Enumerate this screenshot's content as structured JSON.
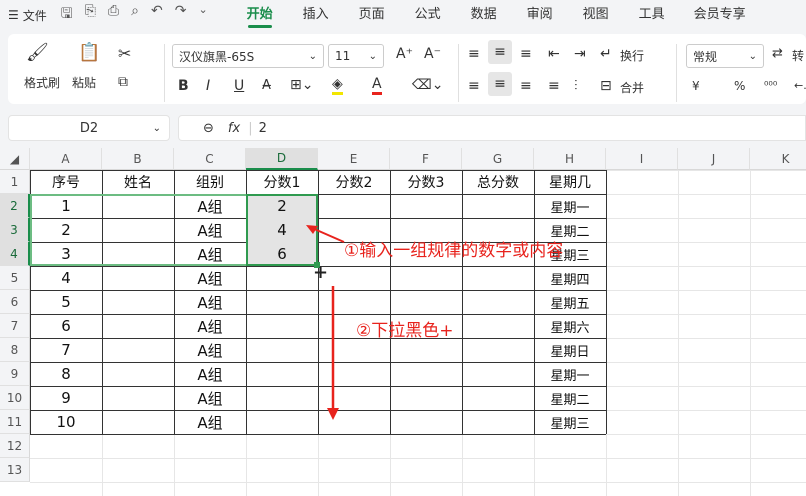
{
  "menu": {
    "file_icon": "hamburger-icon",
    "file": "文件",
    "tabs": [
      "开始",
      "插入",
      "页面",
      "公式",
      "数据",
      "审阅",
      "视图",
      "工具",
      "会员专享"
    ]
  },
  "ribbon": {
    "format_painter": "格式刷",
    "paste": "粘贴",
    "font_name": "汉仪旗黑-65S",
    "font_size": "11",
    "bold": "B",
    "italic": "I",
    "underline": "U",
    "wrap": "换行",
    "merge": "合并",
    "number_format": "常规",
    "convert": "转",
    "currency": "¥",
    "percent": "%"
  },
  "namebox": "D2",
  "formula": "2",
  "fx": "fx",
  "columns": [
    "A",
    "B",
    "C",
    "D",
    "E",
    "F",
    "G",
    "H",
    "I",
    "J",
    "K"
  ],
  "rows": [
    "1",
    "2",
    "3",
    "4",
    "5",
    "6",
    "7",
    "8",
    "9",
    "10",
    "11",
    "12",
    "13"
  ],
  "headers": [
    "序号",
    "姓名",
    "组别",
    "分数1",
    "分数2",
    "分数3",
    "总分数",
    "星期几"
  ],
  "table": [
    [
      "1",
      "",
      "A组",
      "2",
      "星期一"
    ],
    [
      "2",
      "",
      "A组",
      "4",
      "星期二"
    ],
    [
      "3",
      "",
      "A组",
      "6",
      "星期三"
    ],
    [
      "4",
      "",
      "A组",
      "",
      "星期四"
    ],
    [
      "5",
      "",
      "A组",
      "",
      "星期五"
    ],
    [
      "6",
      "",
      "A组",
      "",
      "星期六"
    ],
    [
      "7",
      "",
      "A组",
      "",
      "星期日"
    ],
    [
      "8",
      "",
      "A组",
      "",
      "星期一"
    ],
    [
      "9",
      "",
      "A组",
      "",
      "星期二"
    ],
    [
      "10",
      "",
      "A组",
      "",
      "星期三"
    ]
  ],
  "annotations": {
    "a1": "①输入一组规律的数字或内容",
    "a2": "②下拉黑色+"
  },
  "colors": {
    "accent": "#1a8d4b",
    "annotation": "#e8231d"
  }
}
